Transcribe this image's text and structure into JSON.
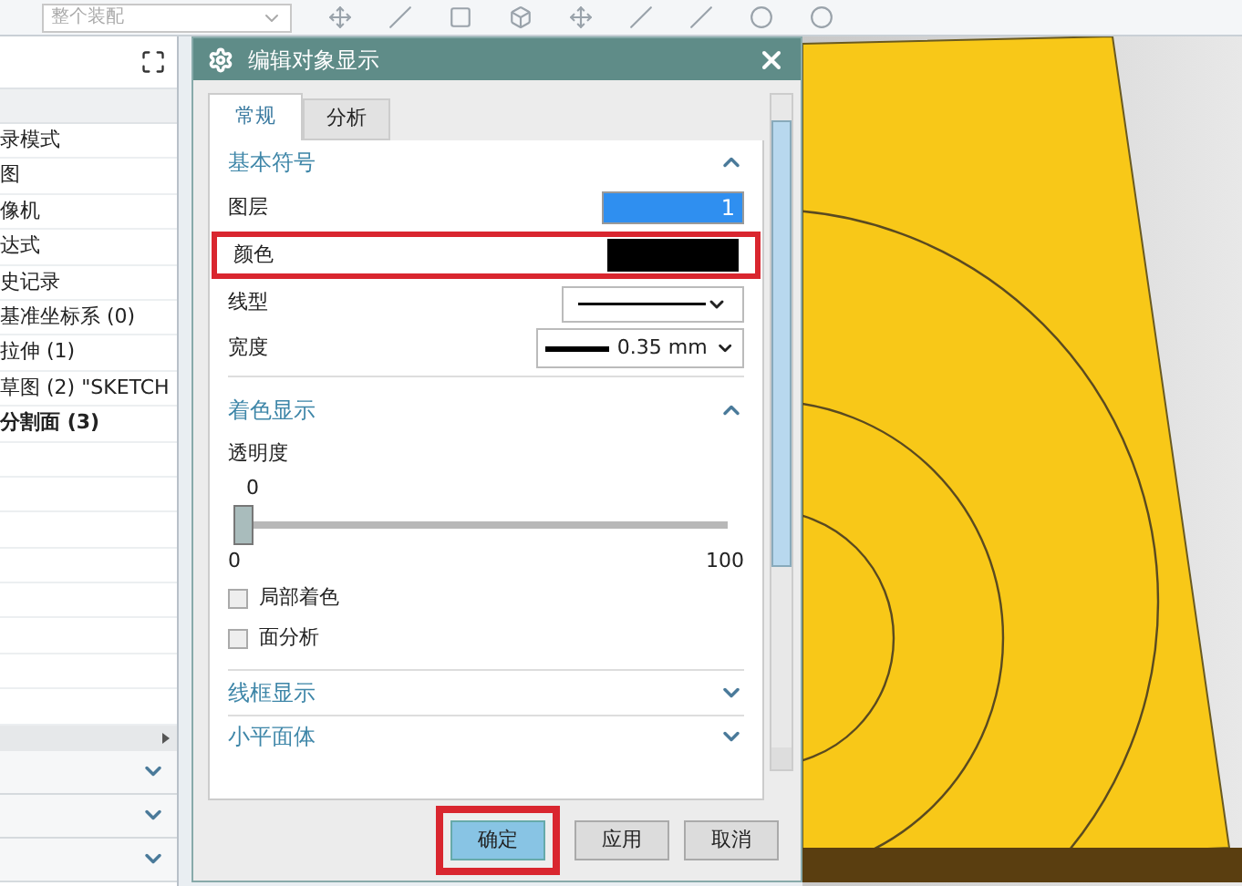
{
  "toolbar": {
    "assembly_dropdown": {
      "value": "整个装配"
    }
  },
  "navigator": {
    "tree_items": [
      {
        "label": "录模式",
        "bold": false
      },
      {
        "label": "图",
        "bold": false
      },
      {
        "label": "像机",
        "bold": false
      },
      {
        "label": "达式",
        "bold": false
      },
      {
        "label": "史记录",
        "bold": false
      },
      {
        "label": "基准坐标系 (0)",
        "bold": false
      },
      {
        "label": "拉伸 (1)",
        "bold": false
      },
      {
        "label": "草图 (2) \"SKETCH",
        "bold": false
      },
      {
        "label": "分割面 (3)",
        "bold": true
      }
    ],
    "bottom_sections": [
      {
        "expanded": false
      },
      {
        "expanded": false
      },
      {
        "expanded": false
      }
    ]
  },
  "dialog": {
    "title": "编辑对象显示",
    "tabs": [
      {
        "label": "常规",
        "selected": true
      },
      {
        "label": "分析",
        "selected": false
      }
    ],
    "basic": {
      "title": "基本符号",
      "expanded": true,
      "layer": {
        "label": "图层",
        "value": "1"
      },
      "color": {
        "label": "颜色",
        "color": "#000000",
        "highlighted": true
      },
      "line_type": {
        "label": "线型"
      },
      "width": {
        "label": "宽度",
        "value": "0.35 mm"
      }
    },
    "shading": {
      "title": "着色显示",
      "expanded": true,
      "transparency": {
        "label": "透明度",
        "reading": "0",
        "level": 0,
        "min": "0",
        "max": "100"
      },
      "checkboxes": [
        {
          "label": "局部着色",
          "checked": false
        },
        {
          "label": "面分析",
          "checked": false
        }
      ]
    },
    "collapsed_sections": [
      {
        "title": "线框显示",
        "expanded": false
      },
      {
        "title": "小平面体",
        "expanded": false
      }
    ],
    "buttons": [
      {
        "label": "确定",
        "kind": "primary",
        "highlighted": true
      },
      {
        "label": "应用",
        "kind": "normal",
        "highlighted": false
      },
      {
        "label": "取消",
        "kind": "normal",
        "highlighted": false
      }
    ]
  }
}
